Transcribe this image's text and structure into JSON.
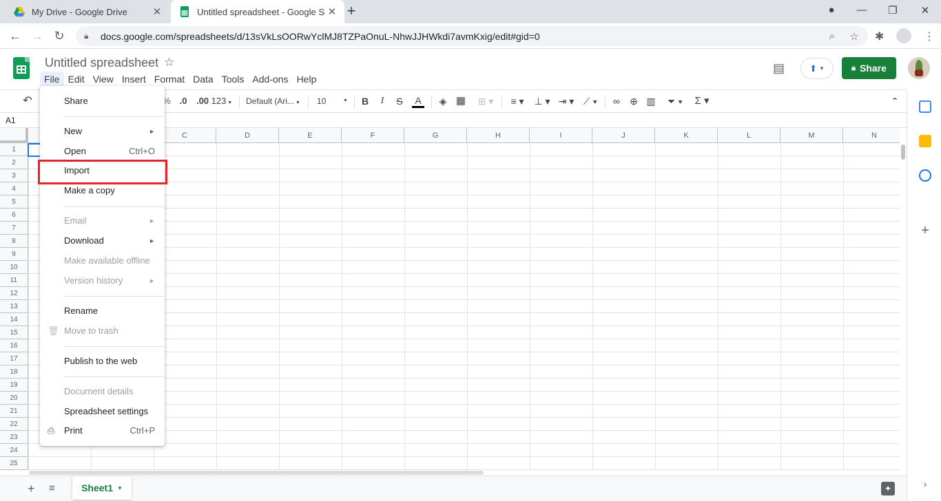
{
  "browser": {
    "tabs": [
      {
        "title": "My Drive - Google Drive",
        "favicon": "google-drive-icon"
      },
      {
        "title": "Untitled spreadsheet - Google Sh",
        "favicon": "google-sheets-icon"
      }
    ],
    "url": "docs.google.com/spreadsheets/d/13sVkLsOORwYclMJ8TZPaOnuL-NhwJJHWkdi7avmKxig/edit#gid=0"
  },
  "doc": {
    "title": "Untitled spreadsheet",
    "share_label": "Share",
    "menus": [
      "File",
      "Edit",
      "View",
      "Insert",
      "Format",
      "Data",
      "Tools",
      "Add-ons",
      "Help"
    ]
  },
  "toolbar": {
    "percent": "%",
    "dec_less": ".0",
    "dec_more": ".00",
    "number_format": "123",
    "font": "Default (Ari...",
    "font_size": "10"
  },
  "name_box": "A1",
  "columns": [
    "C",
    "D",
    "E",
    "F",
    "G",
    "H",
    "I",
    "J",
    "K",
    "L",
    "M",
    "N"
  ],
  "rows": [
    "1",
    "2",
    "3",
    "4",
    "5",
    "6",
    "7",
    "8",
    "9",
    "10",
    "11",
    "12",
    "13",
    "14",
    "15",
    "16",
    "17",
    "18",
    "19",
    "20",
    "21",
    "22",
    "23",
    "24",
    "25"
  ],
  "sheet_tab": "Sheet1",
  "file_menu": {
    "share": "Share",
    "new": "New",
    "open": "Open",
    "open_shortcut": "Ctrl+O",
    "import": "Import",
    "make_copy": "Make a copy",
    "email": "Email",
    "download": "Download",
    "offline": "Make available offline",
    "version_history": "Version history",
    "rename": "Rename",
    "trash": "Move to trash",
    "publish": "Publish to the web",
    "details": "Document details",
    "settings": "Spreadsheet settings",
    "print": "Print",
    "print_shortcut": "Ctrl+P"
  },
  "colors": {
    "share_green": "#188038",
    "highlight_red": "#e3242b",
    "selection_blue": "#1a73e8"
  }
}
